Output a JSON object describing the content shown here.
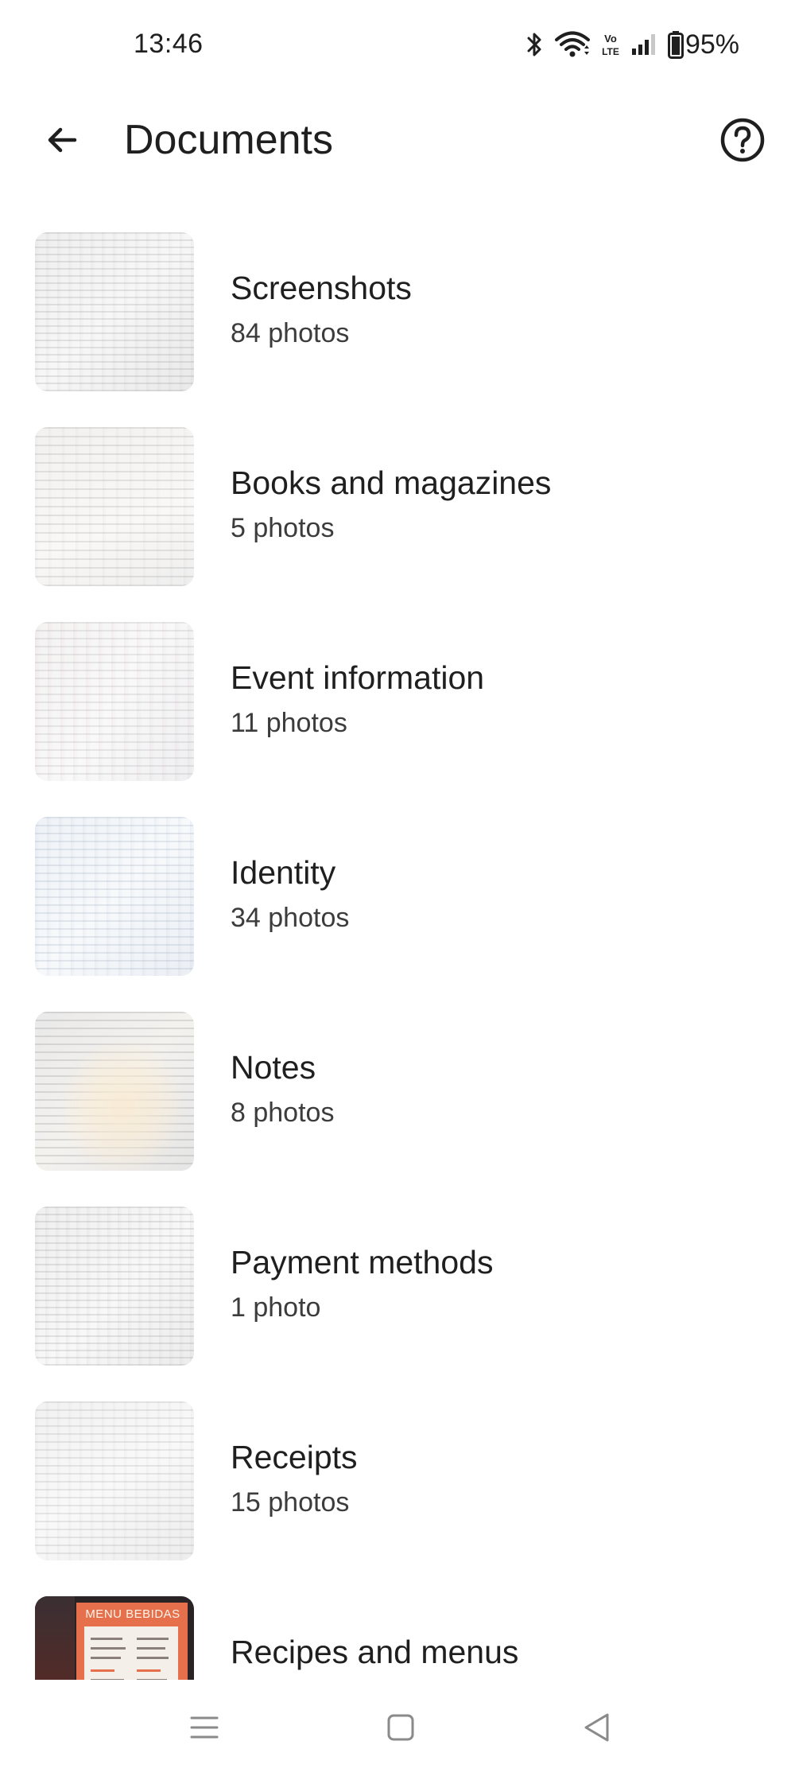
{
  "status_bar": {
    "time": "13:46",
    "battery": "95%",
    "icons": [
      "bluetooth-icon",
      "wifi-icon",
      "volte-icon",
      "signal-icon",
      "battery-icon"
    ]
  },
  "app_bar": {
    "title": "Documents",
    "back_icon": "arrow-back-icon",
    "help_icon": "help-circle-icon"
  },
  "documents": [
    {
      "title": "Screenshots",
      "count": "84 photos"
    },
    {
      "title": "Books and magazines",
      "count": "5 photos"
    },
    {
      "title": "Event information",
      "count": "11 photos"
    },
    {
      "title": "Identity",
      "count": "34 photos"
    },
    {
      "title": "Notes",
      "count": "8 photos"
    },
    {
      "title": "Payment methods",
      "count": "1 photo"
    },
    {
      "title": "Receipts",
      "count": "15 photos"
    },
    {
      "title": "Recipes and menus",
      "count": "",
      "thumb_text": "MENU BEBIDAS"
    }
  ],
  "nav_bar": {
    "icons": [
      "recents-icon",
      "home-icon",
      "back-triangle-icon"
    ]
  },
  "colors": {
    "background": "#ffffff",
    "text_primary": "#1f1f1f",
    "text_secondary": "#3c3c3c"
  }
}
